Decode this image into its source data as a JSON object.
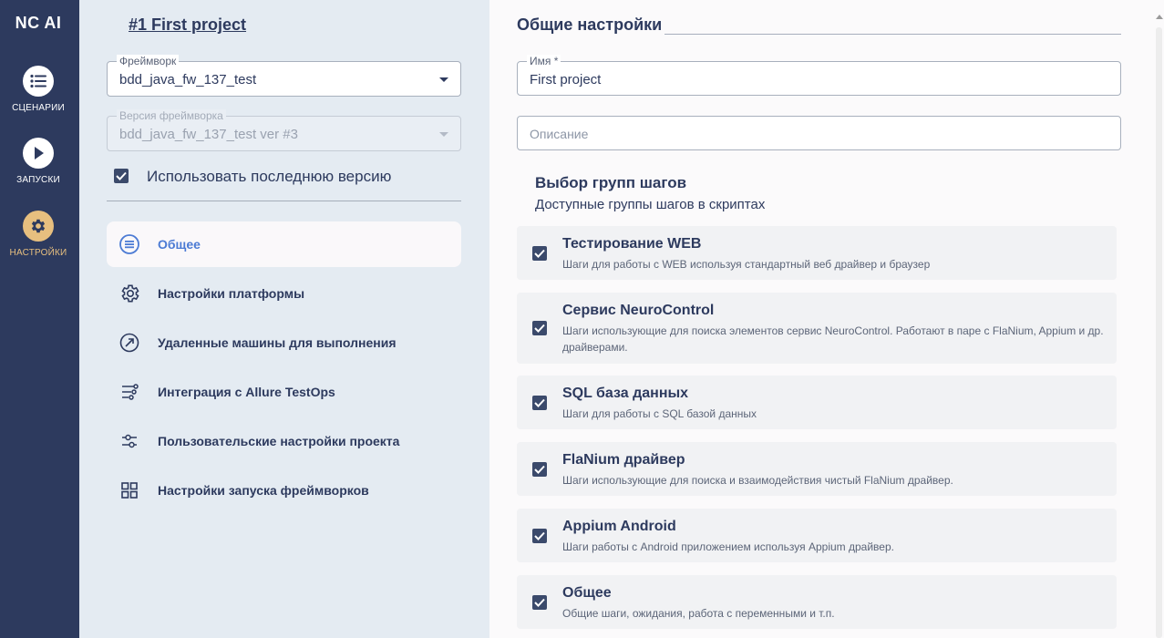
{
  "app": {
    "logo": "NC AI"
  },
  "nav": [
    {
      "label": "СЦЕНАРИИ",
      "icon": "list-icon",
      "active": false
    },
    {
      "label": "ЗАПУСКИ",
      "icon": "play-icon",
      "active": false
    },
    {
      "label": "НАСТРОЙКИ",
      "icon": "gear-icon",
      "active": true
    }
  ],
  "project": {
    "title": "#1 First project"
  },
  "framework": {
    "label": "Фреймворк",
    "value": "bdd_java_fw_137_test"
  },
  "framework_version": {
    "label": "Версия фреймворка",
    "value": "bdd_java_fw_137_test ver #3",
    "disabled": true
  },
  "use_latest": {
    "label": "Использовать последнюю версию",
    "checked": true
  },
  "settings_menu": [
    {
      "label": "Общее",
      "icon": "list-circle-icon",
      "active": true
    },
    {
      "label": "Настройки платформы",
      "icon": "gear-icon",
      "active": false
    },
    {
      "label": "Удаленные машины для выполнения",
      "icon": "remote-icon",
      "active": false
    },
    {
      "label": "Интеграция с Allure TestOps",
      "icon": "integration-icon",
      "active": false
    },
    {
      "label": "Пользовательские настройки проекта",
      "icon": "sliders-icon",
      "active": false
    },
    {
      "label": "Настройки запуска фреймворков",
      "icon": "grid-icon",
      "active": false
    }
  ],
  "general": {
    "title": "Общие настройки",
    "name": {
      "label": "Имя *",
      "value": "First project"
    },
    "description": {
      "placeholder": "Описание"
    }
  },
  "step_groups": {
    "title": "Выбор групп шагов",
    "subtitle": "Доступные группы шагов в скриптах",
    "items": [
      {
        "title": "Тестирование WEB",
        "desc": "Шаги для работы с WEB используя стандартный веб драйвер и браузер",
        "checked": true
      },
      {
        "title": "Сервис NeuroControl",
        "desc": "Шаги использующие для поиска элементов сервис NeuroControl. Работают в паре с FlaNium, Appium и др. драйверами.",
        "checked": true
      },
      {
        "title": "SQL база данных",
        "desc": "Шаги для работы с SQL базой данных",
        "checked": true
      },
      {
        "title": "FlaNium драйвер",
        "desc": "Шаги использующие для поиска и взаимодействия чистый FlaNium драйвер.",
        "checked": true
      },
      {
        "title": "Appium Android",
        "desc": "Шаги работы с Android приложением используя Appium драйвер.",
        "checked": true
      },
      {
        "title": "Общее",
        "desc": "Общие шаги, ожидания, работа с переменными и т.п.",
        "checked": true
      }
    ]
  },
  "colors": {
    "rail": "#2d3a5e",
    "accent": "#e7bf7f",
    "link": "#4c7bd4",
    "panel": "#e4ebf2"
  }
}
